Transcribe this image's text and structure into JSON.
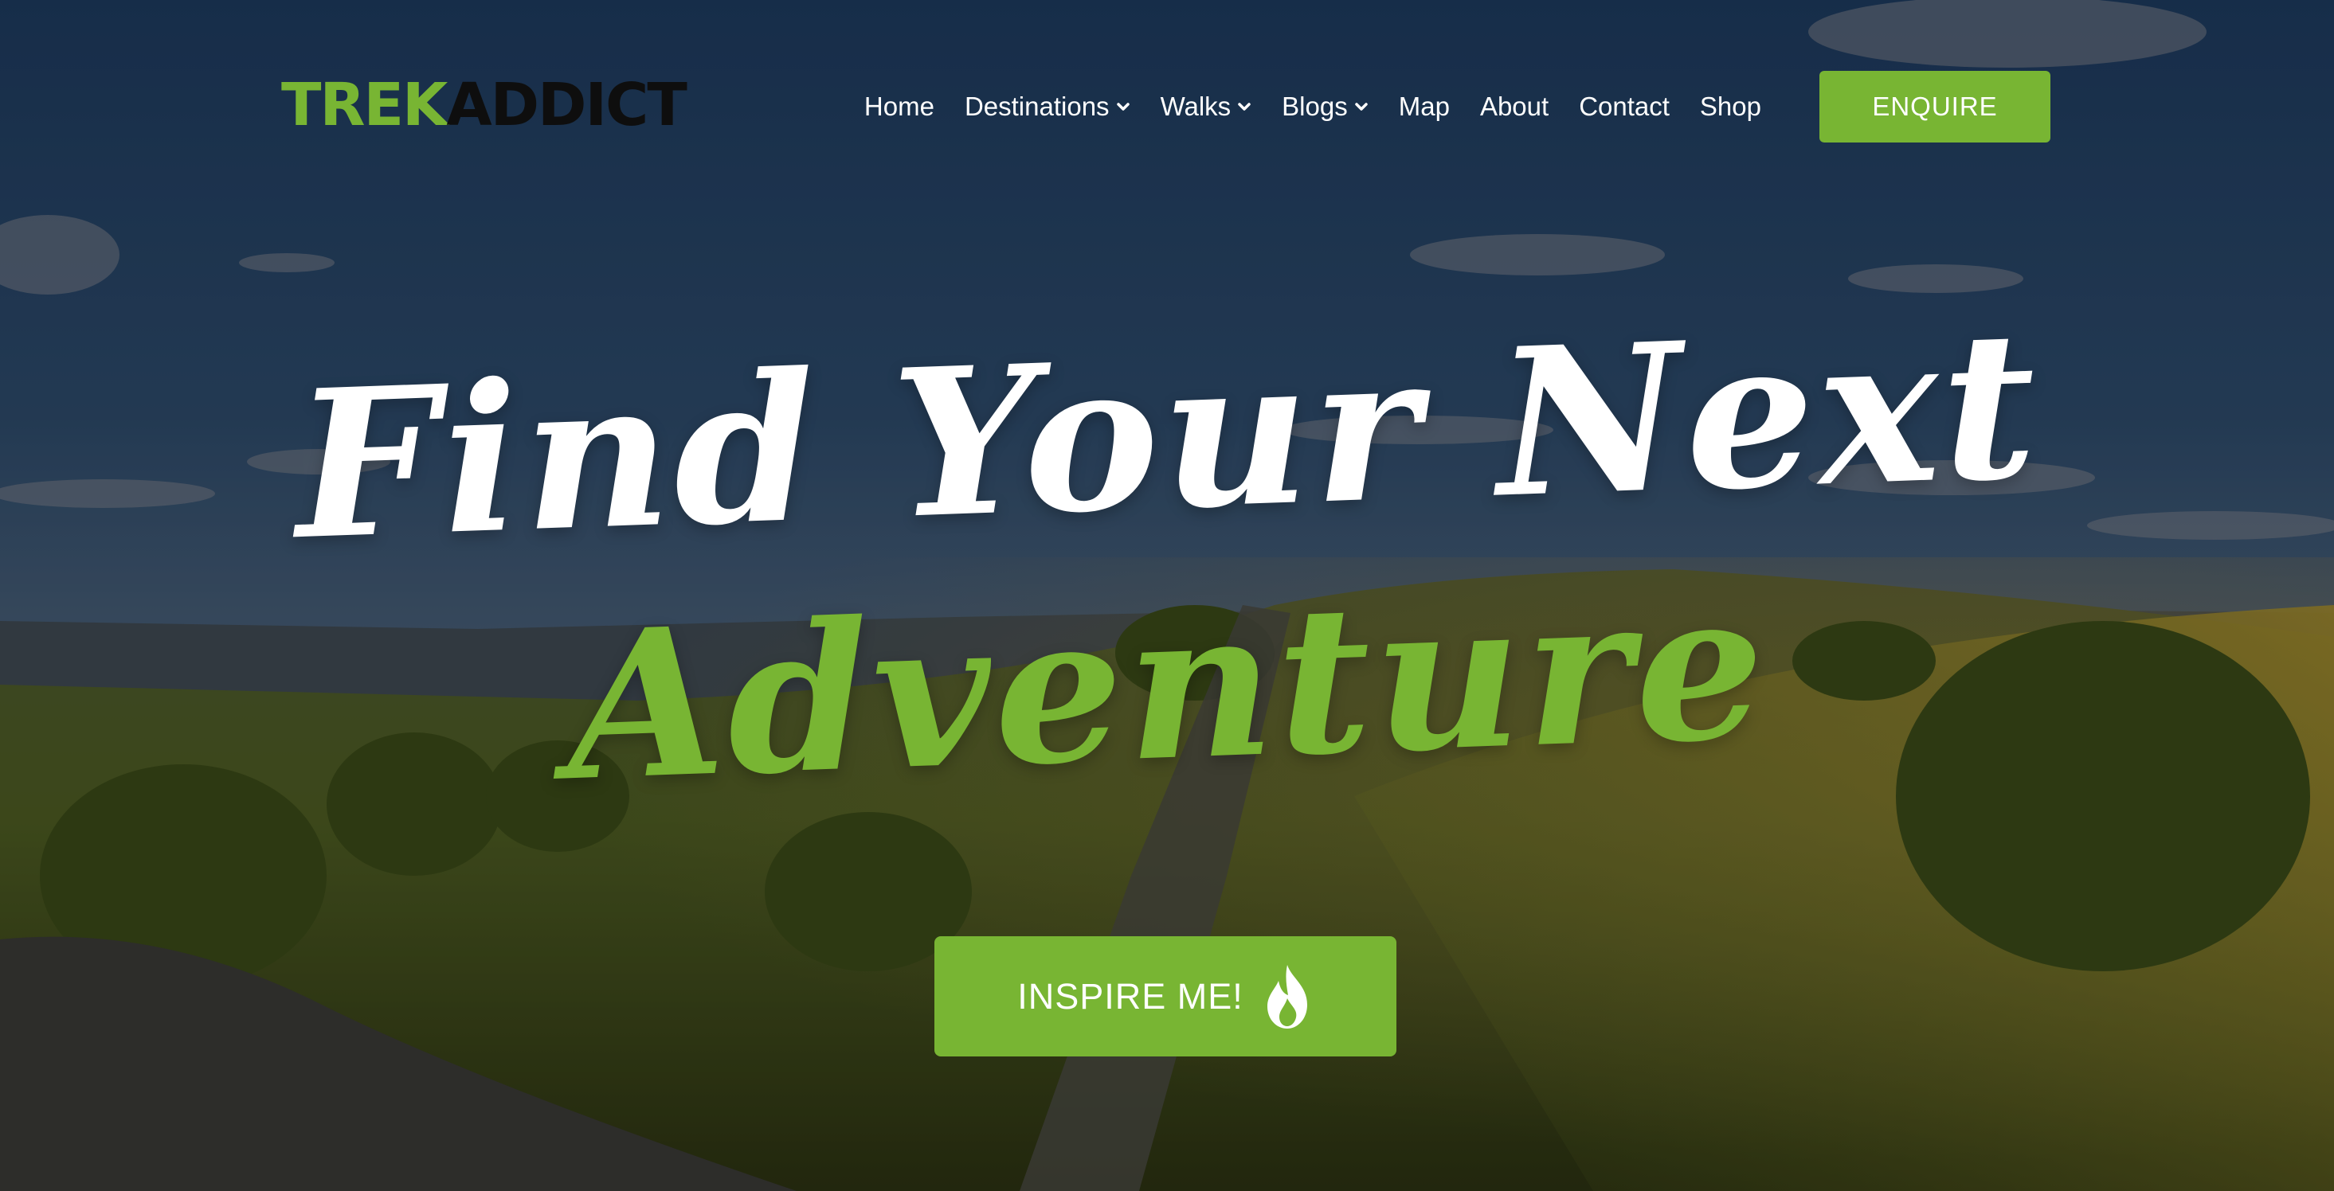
{
  "header": {
    "logo": {
      "part_a": "TREK",
      "part_b": "ADDICT"
    },
    "nav": [
      {
        "label": "Home",
        "dropdown": false
      },
      {
        "label": "Destinations",
        "dropdown": true
      },
      {
        "label": "Walks",
        "dropdown": true
      },
      {
        "label": "Blogs",
        "dropdown": true
      },
      {
        "label": "Map",
        "dropdown": false
      },
      {
        "label": "About",
        "dropdown": false
      },
      {
        "label": "Contact",
        "dropdown": false
      },
      {
        "label": "Shop",
        "dropdown": false
      }
    ],
    "enquire_label": "ENQUIRE"
  },
  "hero": {
    "headline_line1": "Find Your Next",
    "headline_line2": "Adventure",
    "cta_label": "INSPIRE ME!",
    "cta_icon": "flame-icon",
    "background": "sunset-hillside-landscape"
  },
  "colors": {
    "accent": "#78b533",
    "text": "#ffffff",
    "logo_dark": "#0e0e0e"
  }
}
